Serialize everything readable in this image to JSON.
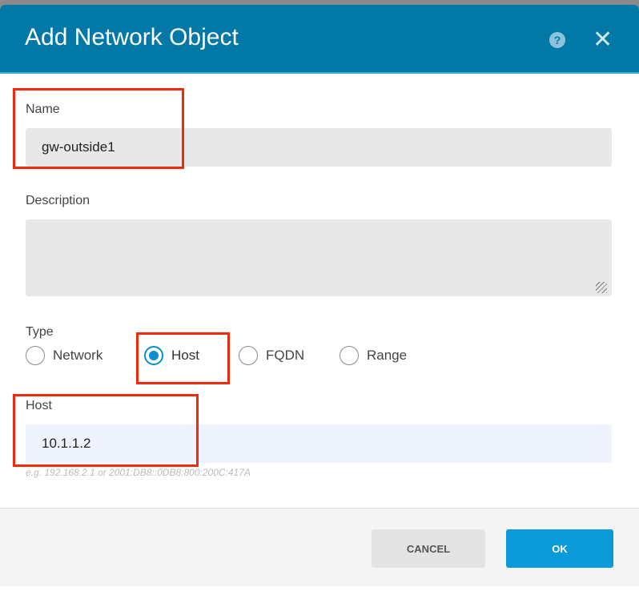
{
  "dialog": {
    "title": "Add Network Object",
    "help_icon": "question-circle-icon",
    "close_icon": "close-icon"
  },
  "name": {
    "label": "Name",
    "value": "gw-outside1"
  },
  "description": {
    "label": "Description",
    "value": ""
  },
  "type": {
    "label": "Type",
    "options": [
      "Network",
      "Host",
      "FQDN",
      "Range"
    ],
    "selected": "Host"
  },
  "host": {
    "label": "Host",
    "value": "10.1.1.2",
    "hint": "e.g. 192.168.2.1 or 2001:DB8::0DB8:800:200C:417A"
  },
  "footer": {
    "cancel": "CANCEL",
    "ok": "OK"
  },
  "colors": {
    "header": "#0278a6",
    "accent": "#0a8fd0",
    "highlight": "#f02a0a"
  }
}
